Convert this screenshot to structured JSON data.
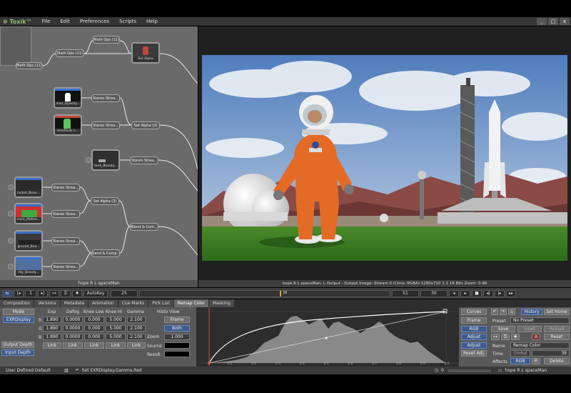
{
  "app": {
    "logo": "❁ Toxik™",
    "menu": [
      "File",
      "Edit",
      "Preferences",
      "Scripts",
      "Help"
    ],
    "window_controls": [
      "_",
      "□",
      "x"
    ]
  },
  "schematic": {
    "nodes": [
      {
        "label": "Math Ops (11)"
      },
      {
        "label": "Math Ops (11)"
      },
      {
        "label": "Math Ops (11)"
      },
      {
        "label": "Stereo Strea..."
      },
      {
        "label": "Stereo Strea..."
      },
      {
        "label": "Set Alpha (2)"
      },
      {
        "label": "Stereo Strea..."
      },
      {
        "label": "Stereo Strea..."
      },
      {
        "label": "Set Alpha (3)"
      },
      {
        "label": "Stereo Strea..."
      },
      {
        "label": "Stereo Strea..."
      },
      {
        "label": "Blend & Com..."
      },
      {
        "label": "Blend & Comp..."
      },
      {
        "label": "Stereo Strea..."
      },
      {
        "label": "Set Alpha"
      }
    ],
    "thumbs": [
      {
        "label": "man_Opacity..."
      },
      {
        "label": "lens01vik s..."
      },
      {
        "label": "tank_Beauty..."
      },
      {
        "label": "rocket_Beau..."
      },
      {
        "label": "more_Mattes..."
      },
      {
        "label": "ground_Bea..."
      },
      {
        "label": "sky_Beauty..."
      }
    ],
    "footer": "hope R L spaceMan"
  },
  "viewer": {
    "status": "hope R L spaceMan: L Output - Output Image: Stream 0 (Chns: RGBA)  1280x720  1:1  16 Bits  Zoom: 0.96"
  },
  "transport": {
    "field1": "1",
    "autokey": "AutoKey",
    "frame": "25",
    "timeline_mark": "38",
    "val1": "51",
    "val2": "30"
  },
  "tabs": [
    "Composition",
    "Versions",
    "Metadata",
    "Animation",
    "Cue Marks",
    "Pick List",
    "Remap Color",
    "Masking"
  ],
  "panel": {
    "mode_label": "Mode",
    "mode_value": "EXRDisplay",
    "output_depth": "Output Depth",
    "input_depth": "Input Depth",
    "columns": [
      "Exp",
      "Defog",
      "Knee Low",
      "Knee Hi",
      "Gamma"
    ],
    "rows": [
      {
        "ch": "R",
        "values": [
          "1.890",
          "0.0000",
          "0.000",
          "5.000",
          "2.100"
        ]
      },
      {
        "ch": "G",
        "values": [
          "1.890",
          "0.0000",
          "0.000",
          "5.000",
          "2.100"
        ]
      },
      {
        "ch": "B",
        "values": [
          "1.890",
          "0.0000",
          "0.000",
          "5.000",
          "2.100"
        ]
      }
    ],
    "link": "Link",
    "histo_view": "Histo View",
    "frame": "Frame",
    "both": "Both",
    "zoom_label": "Zoom",
    "zoom_value": "1.000",
    "source": "Source",
    "result": "Result",
    "curve_ticks": [
      "0.1",
      "0.2",
      "0.3",
      "0.4",
      "0.5",
      "0.6",
      "0.7",
      "0.8",
      "0.9",
      "1.0"
    ],
    "curve_buttons": [
      "Curves",
      "Frame",
      "RGB",
      "Adjust",
      "Adjust",
      "Reset Adj."
    ],
    "right": {
      "history": "History",
      "set_home": "Set Home",
      "preset_label": "Preset",
      "preset_value": "No Preset",
      "save": "Save",
      "load": "Load",
      "reload": "Reload",
      "reset": "Reset",
      "name_label": "Name",
      "name_value": "Remap Color",
      "time_label": "Time",
      "time_field": "Global",
      "time_value": "39",
      "affects_label": "Affects",
      "affects_value": "RGB",
      "affects_extra": "R",
      "delete": "Delete"
    }
  },
  "statusbar": {
    "left": "User Defined Default",
    "action": "Set EXRDisplay.Gamma.Red",
    "zero": "0",
    "right": "hope R L spaceMan"
  }
}
